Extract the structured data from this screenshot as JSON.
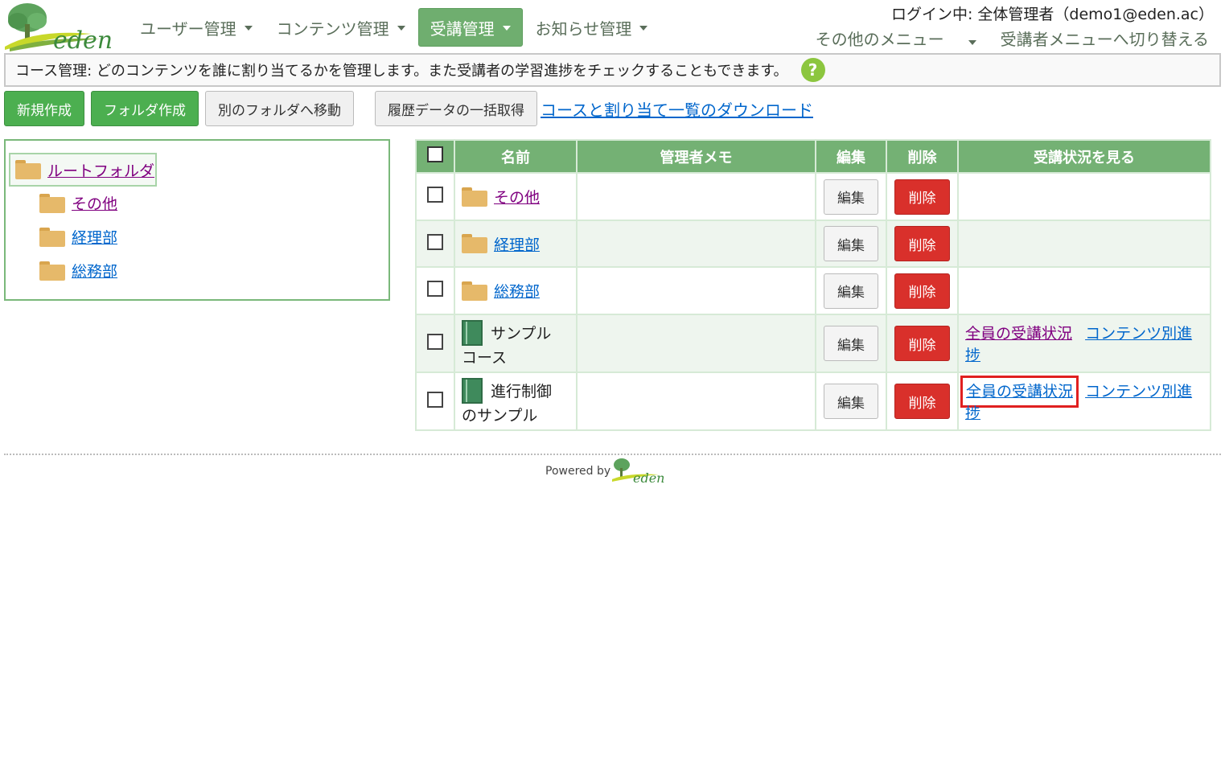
{
  "header": {
    "logo_text": "eden",
    "nav": [
      {
        "label": "ユーザー管理",
        "active": false
      },
      {
        "label": "コンテンツ管理",
        "active": false
      },
      {
        "label": "受講管理",
        "active": true
      },
      {
        "label": "お知らせ管理",
        "active": false
      }
    ],
    "login_text": "ログイン中: 全体管理者（demo1@eden.ac）",
    "other_menu": "その他のメニュー",
    "switch_menu": "受講者メニューへ切り替える"
  },
  "infobar": {
    "text": "コース管理: どのコンテンツを誰に割り当てるかを管理します。また受講者の学習進捗をチェックすることもできます。",
    "help": "?"
  },
  "toolbar": {
    "new": "新規作成",
    "new_folder": "フォルダ作成",
    "move": "別のフォルダへ移動",
    "bulk_history": "履歴データの一括取得",
    "download": "コースと割り当て一覧のダウンロード"
  },
  "tree": {
    "root": "ルートフォルダ",
    "children": [
      "その他",
      "経理部",
      "総務部"
    ]
  },
  "table": {
    "headers": {
      "name": "名前",
      "memo": "管理者メモ",
      "edit": "編集",
      "delete": "削除",
      "view": "受講状況を見る"
    },
    "rows": [
      {
        "type": "folder",
        "name": "その他",
        "memo": "",
        "edit": "編集",
        "delete": "削除"
      },
      {
        "type": "folder",
        "name": "経理部",
        "memo": "",
        "edit": "編集",
        "delete": "削除"
      },
      {
        "type": "folder",
        "name": "総務部",
        "memo": "",
        "edit": "編集",
        "delete": "削除"
      },
      {
        "type": "course",
        "name_line1": "サンプル",
        "name_line2": "コース",
        "memo": "",
        "edit": "編集",
        "delete": "削除",
        "view_all": "全員の受講状況",
        "view_content": "コンテンツ別進捗"
      },
      {
        "type": "course",
        "name_line1": "進行制御",
        "name_line2": "のサンプル",
        "memo": "",
        "edit": "編集",
        "delete": "削除",
        "view_all": "全員の受講状況",
        "view_content": "コンテンツ別進捗"
      }
    ]
  },
  "footer": {
    "powered_by": "Powered by",
    "logo_text": "eden"
  }
}
